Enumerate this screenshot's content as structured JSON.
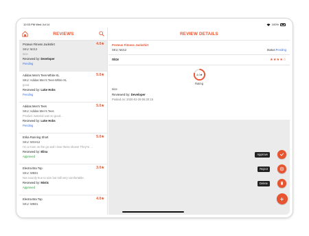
{
  "status_bar": {
    "time_date": "12:03 PM  Wed Jul 14",
    "battery": "100%"
  },
  "list": {
    "title": "REVIEWS",
    "items": [
      {
        "name": "Proteus Fitness Jackshirt",
        "rating": "4.0★",
        "sku": "SKU: MJ12",
        "title": "nice",
        "by_prefix": "Reviewed by: ",
        "by_name": "Developer",
        "status": "Pending",
        "status_color": "#3b6fe0"
      },
      {
        "name": "Adidas Men's Tees-White-XL",
        "rating": "5.0★",
        "sku": "SKU: Adidas Men's Tees-White-XL",
        "title": "good",
        "by_prefix": "Reviewed by: ",
        "by_name": "Luke Hobs",
        "status": "Pending",
        "status_color": "#3b6fe0"
      },
      {
        "name": "Adidas Men's Tees",
        "rating": "5.0★",
        "sku": "SKU: Adidas Men's Tees",
        "title": "Product material was so good...",
        "by_prefix": "Reviewed by: ",
        "by_name": "Luke Hobs",
        "status": "Pending",
        "status_color": "#3b6fe0"
      },
      {
        "name": "Erika Running Short",
        "rating": "5.0★",
        "sku": "SKU: WSH12",
        "title": "I'm a mom on the go and I love these shoes! They're ...",
        "by_prefix": "Reviewed by: ",
        "by_name": "Elina",
        "status": "Approved",
        "status_color": "#2e9a3c"
      },
      {
        "name": "Electra Bra Top",
        "rating": "3.0★",
        "sku": "SKU: WB01",
        "title": "Not exactly true to size but still very comfortable.",
        "by_prefix": "Reviewed by: ",
        "by_name": "Mistic",
        "status": "Approved",
        "status_color": "#2e9a3c"
      },
      {
        "name": "Electra Bra Top",
        "rating": "4.0★",
        "sku": "SKU: WB01",
        "title": "",
        "by_prefix": "",
        "by_name": "",
        "status": "",
        "status_color": "#2e9a3c"
      }
    ]
  },
  "detail": {
    "title": "REVIEW DETAILS",
    "product_name": "Proteus Fitness Jackshirt",
    "sku": "SKU: MJ12",
    "status_label": "Status: ",
    "status_value": "Pending",
    "review_title": "nice",
    "stars": "★★★★☆",
    "rating_value": "4.0★",
    "rating_fraction": 0.8,
    "rating_label": "Rating",
    "review_text": "nice",
    "reviewed_by_prefix": "Reviewed by: ",
    "reviewed_by_name": "Developer",
    "posted_on": "Posted on: 2020-02-29 06:20:15"
  },
  "actions": {
    "approve": "Approve",
    "reject": "Reject",
    "delete": "Delete"
  },
  "colors": {
    "accent": "#e8542f",
    "pending": "#3b6fe0",
    "approved": "#2e9a3c"
  }
}
